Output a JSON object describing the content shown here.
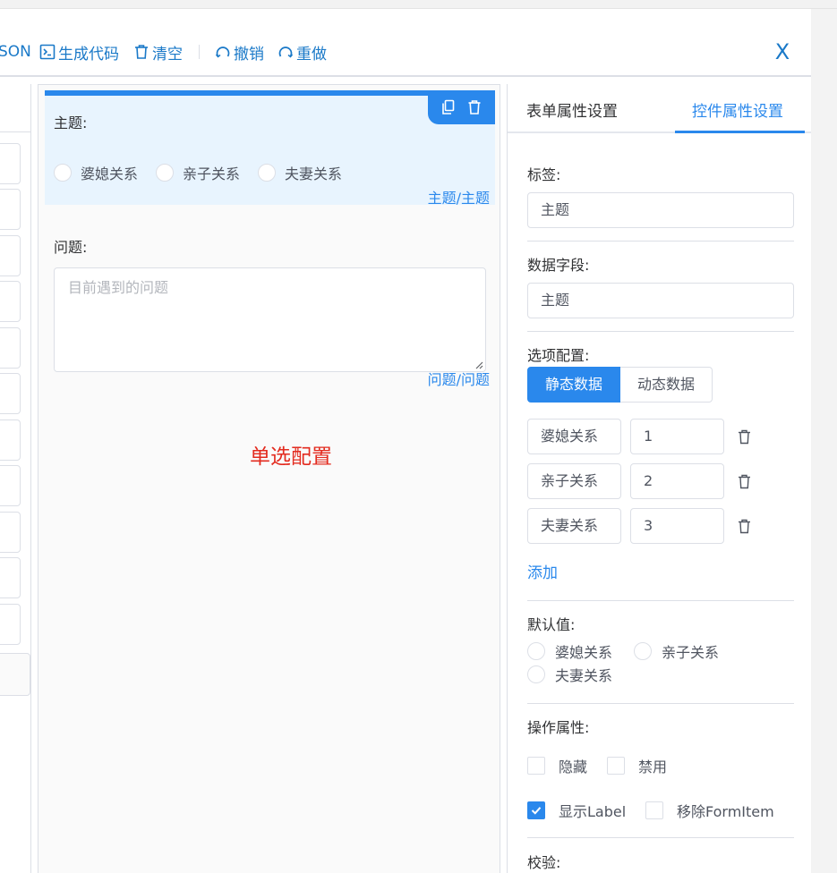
{
  "toolbar": {
    "partial_label": "SON",
    "generate_code": "生成代码",
    "clear": "清空",
    "undo": "撤销",
    "redo": "重做",
    "close": "X"
  },
  "canvas": {
    "fields": [
      {
        "label": "主题:",
        "options": [
          "婆媳关系",
          "亲子关系",
          "夫妻关系"
        ],
        "key": "主题/主题"
      },
      {
        "label": "问题:",
        "placeholder": "目前遇到的问题",
        "key": "问题/问题"
      }
    ],
    "note": "单选配置"
  },
  "right_panel": {
    "tabs": [
      "表单属性设置",
      "控件属性设置"
    ],
    "active_tab": 1,
    "label_title": "标签:",
    "label_value": "主题",
    "field_title": "数据字段:",
    "field_value": "主题",
    "options_title": "选项配置:",
    "source_buttons": [
      "静态数据",
      "动态数据"
    ],
    "options": [
      {
        "label": "婆媳关系",
        "value": "1"
      },
      {
        "label": "亲子关系",
        "value": "2"
      },
      {
        "label": "夫妻关系",
        "value": "3"
      }
    ],
    "add": "添加",
    "default_title": "默认值:",
    "default_options": [
      "婆媳关系",
      "亲子关系",
      "夫妻关系"
    ],
    "operation_title": "操作属性:",
    "checkboxes": [
      {
        "label": "隐藏",
        "checked": false
      },
      {
        "label": "禁用",
        "checked": false
      },
      {
        "label": "显示Label",
        "checked": true
      },
      {
        "label": "移除FormItem",
        "checked": false
      }
    ],
    "validation_title": "校验:"
  },
  "colors": {
    "accent": "#2a88ec",
    "link": "#1a79c8",
    "active_field_bg": "#e8f4fe",
    "note": "#e32b1f"
  },
  "icons": [
    "terminal-icon",
    "trash-icon",
    "undo-icon",
    "redo-icon",
    "copy-icon"
  ]
}
